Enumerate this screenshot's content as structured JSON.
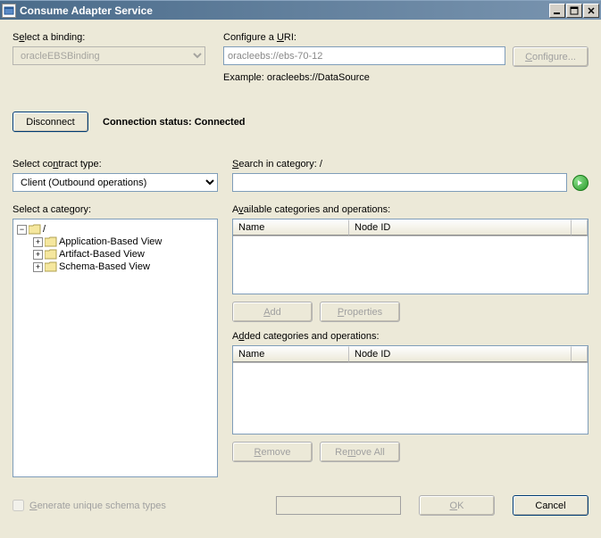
{
  "titlebar": {
    "title": "Consume Adapter Service"
  },
  "binding": {
    "label_pre": "S",
    "label_u": "e",
    "label_post": "lect a binding:",
    "value": "oracleEBSBinding"
  },
  "uri": {
    "label_pre": "Configure a ",
    "label_u": "U",
    "label_post": "RI:",
    "value": "oracleebs://ebs-70-12",
    "configure_btn": "Configure...",
    "example": "Example: oracleebs://DataSource"
  },
  "connection": {
    "disconnect_btn": "Disconnect",
    "status_label": "Connection status:",
    "status_value": "Connected"
  },
  "contract": {
    "label_pre": "Select co",
    "label_u": "n",
    "label_post": "tract type:",
    "value": "Client (Outbound operations)"
  },
  "search": {
    "label_u": "S",
    "label_post": "earch in category: /",
    "value": ""
  },
  "category": {
    "label": "Select a category:",
    "root": "/",
    "children": [
      "Application-Based View",
      "Artifact-Based View",
      "Schema-Based View"
    ]
  },
  "available": {
    "label_pre": "A",
    "label_u": "v",
    "label_post": "ailable categories and operations:",
    "col_name": "Name",
    "col_nodeid": "Node ID",
    "add_btn": "Add",
    "props_btn": "Properties"
  },
  "added": {
    "label_pre": "A",
    "label_u": "d",
    "label_post": "ded categories and operations:",
    "col_name": "Name",
    "col_nodeid": "Node ID",
    "remove_btn": "Remove",
    "removeall_btn": "Remove All"
  },
  "bottom": {
    "checkbox_pre": "",
    "checkbox_u": "G",
    "checkbox_post": "enerate unique schema types",
    "ok_btn": "OK",
    "cancel_btn": "Cancel"
  }
}
